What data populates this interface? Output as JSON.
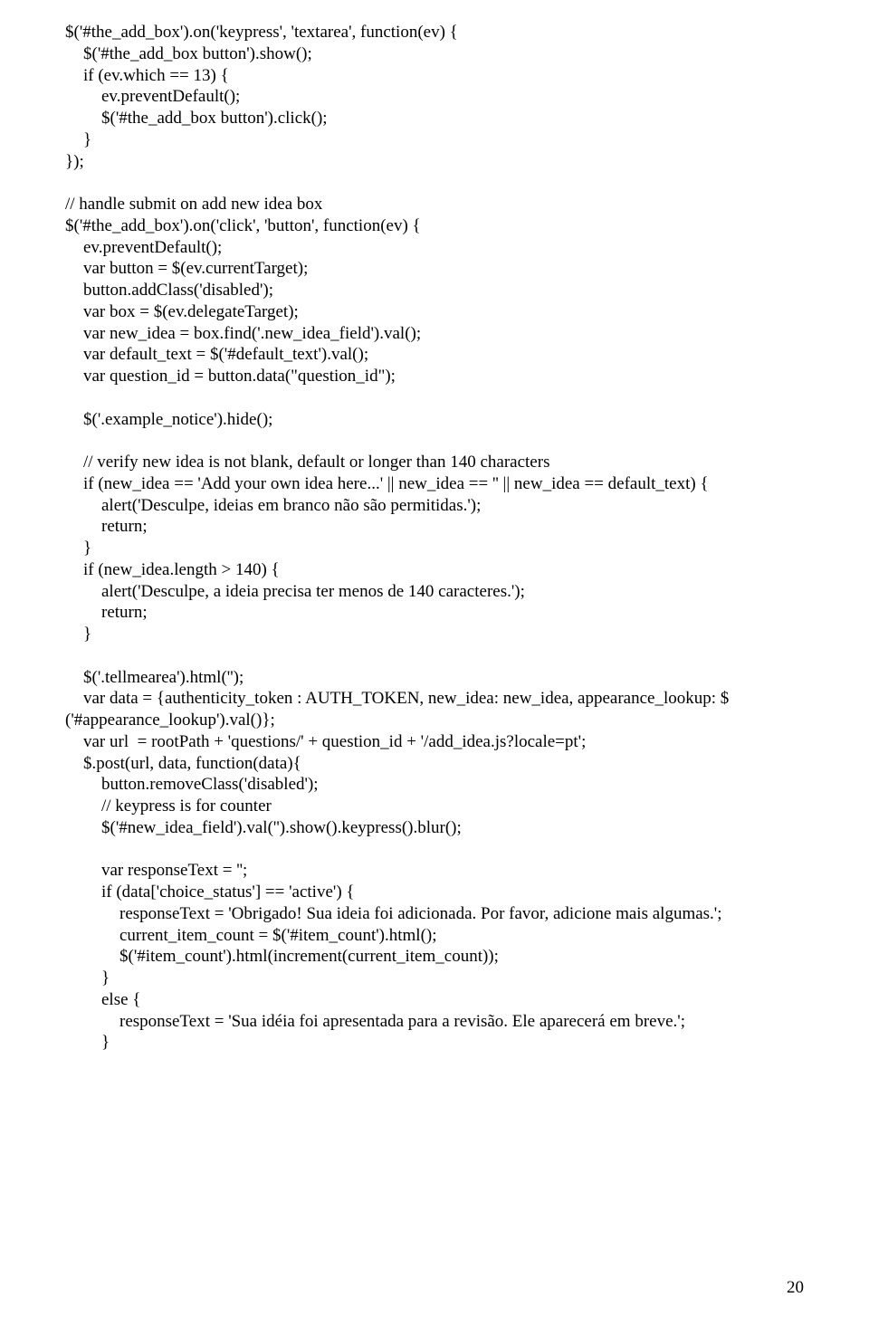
{
  "lines": [
    {
      "cls": "",
      "text": "$('#the_add_box').on('keypress', 'textarea', function(ev) {"
    },
    {
      "cls": "indent1",
      "text": "$('#the_add_box button').show();"
    },
    {
      "cls": "indent1",
      "text": "if (ev.which == 13) {"
    },
    {
      "cls": "indent2",
      "text": "ev.preventDefault();"
    },
    {
      "cls": "indent2",
      "text": "$('#the_add_box button').click();"
    },
    {
      "cls": "indent1",
      "text": "}"
    },
    {
      "cls": "",
      "text": "});"
    },
    {
      "cls": "blank",
      "text": ""
    },
    {
      "cls": "",
      "text": "// handle submit on add new idea box"
    },
    {
      "cls": "",
      "text": "$('#the_add_box').on('click', 'button', function(ev) {"
    },
    {
      "cls": "indent1",
      "text": "ev.preventDefault();"
    },
    {
      "cls": "indent1",
      "text": "var button = $(ev.currentTarget);"
    },
    {
      "cls": "indent1",
      "text": "button.addClass('disabled');"
    },
    {
      "cls": "indent1",
      "text": "var box = $(ev.delegateTarget);"
    },
    {
      "cls": "indent1",
      "text": "var new_idea = box.find('.new_idea_field').val();"
    },
    {
      "cls": "indent1",
      "text": "var default_text = $('#default_text').val();"
    },
    {
      "cls": "indent1",
      "text": "var question_id = button.data(\"question_id\");"
    },
    {
      "cls": "blank",
      "text": ""
    },
    {
      "cls": "indent1",
      "text": "$('.example_notice').hide();"
    },
    {
      "cls": "blank",
      "text": ""
    },
    {
      "cls": "indent1",
      "text": "// verify new idea is not blank, default or longer than 140 characters"
    },
    {
      "cls": "indent1",
      "text": "if (new_idea == 'Add your own idea here...' || new_idea == '' || new_idea == default_text) {"
    },
    {
      "cls": "indent2",
      "text": "alert('Desculpe, ideias em branco não são permitidas.');"
    },
    {
      "cls": "indent2",
      "text": "return;"
    },
    {
      "cls": "indent1",
      "text": "}"
    },
    {
      "cls": "indent1",
      "text": "if (new_idea.length > 140) {"
    },
    {
      "cls": "indent2",
      "text": "alert('Desculpe, a ideia precisa ter menos de 140 caracteres.');"
    },
    {
      "cls": "indent2",
      "text": "return;"
    },
    {
      "cls": "indent1",
      "text": "}"
    },
    {
      "cls": "blank",
      "text": ""
    },
    {
      "cls": "indent1",
      "text": "$('.tellmearea').html('');"
    },
    {
      "cls": "indent1",
      "text": "var data = {authenticity_token : AUTH_TOKEN, new_idea: new_idea, appearance_lookup: $"
    },
    {
      "cls": "",
      "text": "('#appearance_lookup').val()};"
    },
    {
      "cls": "indent1",
      "text": "var url  = rootPath + 'questions/' + question_id + '/add_idea.js?locale=pt';"
    },
    {
      "cls": "indent1",
      "text": "$.post(url, data, function(data){"
    },
    {
      "cls": "indent2",
      "text": "button.removeClass('disabled');"
    },
    {
      "cls": "indent2",
      "text": "// keypress is for counter"
    },
    {
      "cls": "indent2",
      "text": "$('#new_idea_field').val('').show().keypress().blur();"
    },
    {
      "cls": "blank",
      "text": ""
    },
    {
      "cls": "indent2",
      "text": "var responseText = '';"
    },
    {
      "cls": "indent2",
      "text": "if (data['choice_status'] == 'active') {"
    },
    {
      "cls": "indent3",
      "text": "responseText = 'Obrigado! Sua ideia foi adicionada. Por favor, adicione mais algumas.';"
    },
    {
      "cls": "indent3",
      "text": "current_item_count = $('#item_count').html();"
    },
    {
      "cls": "indent3",
      "text": "$('#item_count').html(increment(current_item_count));"
    },
    {
      "cls": "indent2",
      "text": "}"
    },
    {
      "cls": "indent2",
      "text": "else {"
    },
    {
      "cls": "indent3",
      "text": "responseText = 'Sua idéia foi apresentada para a revisão. Ele aparecerá em breve.';"
    },
    {
      "cls": "indent2",
      "text": "}"
    }
  ],
  "page_number": "20"
}
